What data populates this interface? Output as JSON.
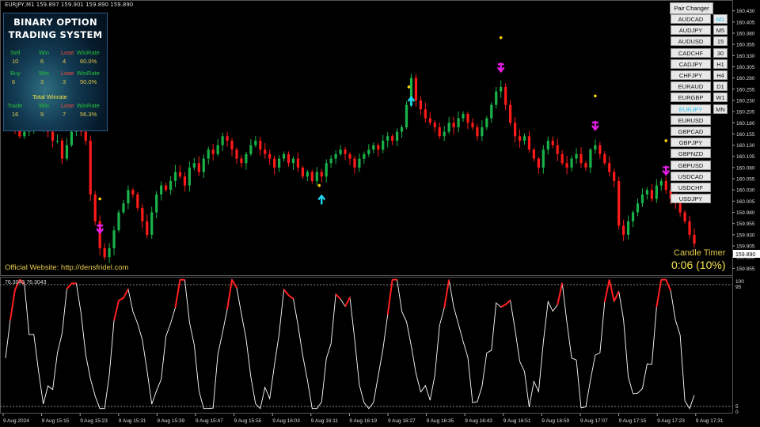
{
  "header": {
    "symbol_info": "EURJPY,M1  159.897 159.901 159.890 159.890"
  },
  "panel": {
    "title_line1": "BINARY OPTION",
    "title_line2": "TRADING SYSTEM",
    "sell": {
      "label": "Sell",
      "count": "10",
      "win_label": "Win",
      "win": "6",
      "lose_label": "Lose",
      "lose": "4",
      "rate_label": "WinRate",
      "rate": "60.0%"
    },
    "buy": {
      "label": "Buy",
      "count": "6",
      "win_label": "Win",
      "win": "3",
      "lose_label": "Lose",
      "lose": "3",
      "rate_label": "WinRate",
      "rate": "50.0%"
    },
    "total_title": "Total Winrate",
    "trade": {
      "label": "Trade",
      "count": "16",
      "win_label": "Win",
      "win": "9",
      "lose_label": "Lose",
      "lose": "7",
      "rate_label": "WinRate",
      "rate": "56.3%"
    }
  },
  "pair_changer": {
    "title": "Pair Changer",
    "pairs": [
      "AUDCAD",
      "AUDJPY",
      "AUDUSD",
      "CADCHF",
      "CADJPY",
      "CHFJPY",
      "EURAUD",
      "EURGBP",
      "EURJPY",
      "EURUSD",
      "GBPCAD",
      "GBPJPY",
      "GBPNZD",
      "GBPUSD",
      "USDCAD",
      "USDCHF",
      "USDJPY"
    ],
    "active_pair": "EURJPY",
    "timeframes": [
      "M1",
      "M5",
      "15",
      "30",
      "H1",
      "H4",
      "D1",
      "W1",
      "MN"
    ],
    "active_timeframe": "M1"
  },
  "website": "Official Website: http://densfridel.com",
  "candle_timer": {
    "label": "Candle Timer",
    "value": "0:06 (10%)"
  },
  "price_axis": {
    "labels": [
      "160.430",
      "160.405",
      "160.380",
      "160.355",
      "160.330",
      "160.305",
      "160.280",
      "160.255",
      "160.230",
      "160.205",
      "160.180",
      "160.155",
      "160.130",
      "160.105",
      "160.080",
      "160.055",
      "160.030",
      "160.005",
      "159.980",
      "159.955",
      "159.930",
      "159.905",
      "159.880",
      "159.855"
    ],
    "current_price": "159.890"
  },
  "oscillator": {
    "label": "76.3043 76.3043",
    "scale_labels": [
      "100",
      "95",
      "5",
      "0"
    ]
  },
  "time_axis": {
    "labels": [
      "9 Aug 2024",
      "9 Aug 15:15",
      "9 Aug 15:23",
      "9 Aug 15:31",
      "9 Aug 15:39",
      "9 Aug 15:47",
      "9 Aug 15:55",
      "9 Aug 16:03",
      "9 Aug 16:11",
      "9 Aug 16:19",
      "9 Aug 16:27",
      "9 Aug 16:35",
      "9 Aug 16:43",
      "9 Aug 16:51",
      "9 Aug 16:59",
      "9 Aug 17:07",
      "9 Aug 17:15",
      "9 Aug 17:23",
      "9 Aug 17:31"
    ]
  },
  "colors": {
    "bull": "#19b34a",
    "bear": "#ff1a1a",
    "up_arrow": "#22d3f0",
    "down_arrow": "#e21ee2",
    "dot": "#ffd700",
    "osc_line": "#ffffff",
    "osc_hot": "#ff2020"
  },
  "chart_data": {
    "type": "candlestick",
    "symbol": "EURJPY",
    "timeframe": "M1",
    "ylim": [
      159.845,
      160.44
    ],
    "closes": [
      160.2,
      160.18,
      160.17,
      160.15,
      160.16,
      160.17,
      160.18,
      160.17,
      160.18,
      160.16,
      160.14,
      160.14,
      160.1,
      160.13,
      160.16,
      160.17,
      160.16,
      160.14,
      160.02,
      159.96,
      159.9,
      159.88,
      159.9,
      159.94,
      159.98,
      160.0,
      160.03,
      160.02,
      159.99,
      159.96,
      159.93,
      159.98,
      160.02,
      160.04,
      160.03,
      160.05,
      160.07,
      160.06,
      160.04,
      160.08,
      160.09,
      160.07,
      160.1,
      160.12,
      160.11,
      160.13,
      160.15,
      160.14,
      160.12,
      160.1,
      160.09,
      160.11,
      160.13,
      160.14,
      160.12,
      160.11,
      160.1,
      160.08,
      160.1,
      160.11,
      160.09,
      160.1,
      160.08,
      160.06,
      160.07,
      160.05,
      160.07,
      160.06,
      160.09,
      160.1,
      160.11,
      160.12,
      160.11,
      160.1,
      160.08,
      160.1,
      160.11,
      160.12,
      160.13,
      160.12,
      160.14,
      160.15,
      160.14,
      160.16,
      160.17,
      160.22,
      160.28,
      160.23,
      160.21,
      160.19,
      160.18,
      160.17,
      160.15,
      160.16,
      160.18,
      160.17,
      160.19,
      160.2,
      160.18,
      160.17,
      160.15,
      160.17,
      160.19,
      160.22,
      160.25,
      160.26,
      160.22,
      160.18,
      160.15,
      160.14,
      160.15,
      160.12,
      160.1,
      160.08,
      160.12,
      160.14,
      160.13,
      160.11,
      160.09,
      160.08,
      160.1,
      160.11,
      160.09,
      160.08,
      160.12,
      160.13,
      160.11,
      160.09,
      160.07,
      160.05,
      159.95,
      159.93,
      159.96,
      159.98,
      160.0,
      160.02,
      160.03,
      160.01,
      160.04,
      160.05,
      160.03,
      160.01,
      160.0,
      159.98,
      159.96,
      159.93,
      159.91
    ]
  }
}
